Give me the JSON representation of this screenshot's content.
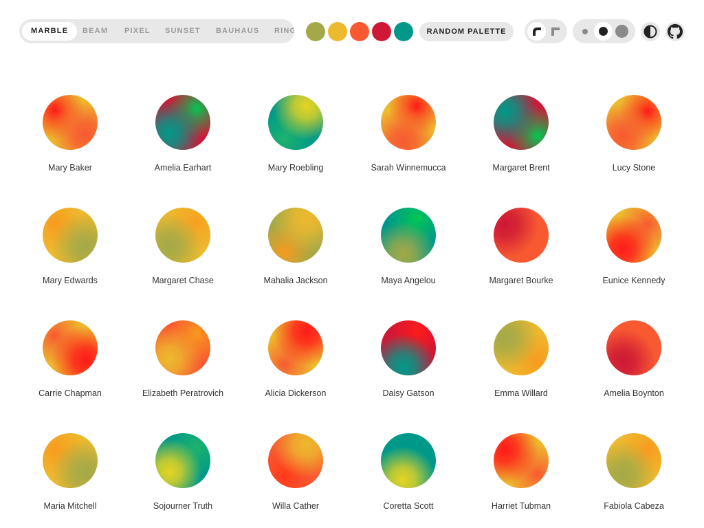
{
  "toolbar": {
    "tabs": [
      {
        "label": "MARBLE",
        "active": true
      },
      {
        "label": "BEAM",
        "active": false
      },
      {
        "label": "PIXEL",
        "active": false
      },
      {
        "label": "SUNSET",
        "active": false
      },
      {
        "label": "BAUHAUS",
        "active": false
      },
      {
        "label": "RING",
        "active": false
      }
    ],
    "palette": [
      "#a3a948",
      "#edb92e",
      "#f85931",
      "#ce1836",
      "#009989"
    ],
    "random_palette_label": "RANDOM PALETTE",
    "shape_toggle": {
      "icons": [
        "rounded-corner-icon",
        "square-corner-icon"
      ],
      "active": 0
    },
    "size_toggle": {
      "icons": [
        "small-dot-icon",
        "medium-dot-icon",
        "large-dot-icon"
      ],
      "active": 1
    },
    "dark_mode_icon": "contrast-icon",
    "github_icon": "github-icon"
  },
  "avatars": [
    {
      "name": "Mary Baker",
      "colors": [
        "#edb92e",
        "#f85931",
        "#ff1a1a"
      ]
    },
    {
      "name": "Amelia Earhart",
      "colors": [
        "#ce1836",
        "#009989",
        "#00c853"
      ]
    },
    {
      "name": "Mary Roebling",
      "colors": [
        "#009989",
        "#e6d422",
        "#1fb36b"
      ]
    },
    {
      "name": "Sarah Winnemucca",
      "colors": [
        "#edb92e",
        "#f85931",
        "#ff1a1a"
      ]
    },
    {
      "name": "Margaret Brent",
      "colors": [
        "#ce1836",
        "#009989",
        "#00c853"
      ]
    },
    {
      "name": "Lucy Stone",
      "colors": [
        "#edb92e",
        "#f85931",
        "#ff1a1a"
      ]
    },
    {
      "name": "Mary Edwards",
      "colors": [
        "#edb92e",
        "#a3a948",
        "#f89a1e"
      ]
    },
    {
      "name": "Margaret Chase",
      "colors": [
        "#edb92e",
        "#a3a948",
        "#f8a01e"
      ]
    },
    {
      "name": "Mahalia Jackson",
      "colors": [
        "#a3a948",
        "#edb92e",
        "#f89a1e"
      ]
    },
    {
      "name": "Maya Angelou",
      "colors": [
        "#009989",
        "#a3a948",
        "#00c853"
      ]
    },
    {
      "name": "Margaret Bourke",
      "colors": [
        "#f85931",
        "#ce1836",
        "#f85931"
      ]
    },
    {
      "name": "Eunice Kennedy",
      "colors": [
        "#edb92e",
        "#ff1a1a",
        "#f85931"
      ]
    },
    {
      "name": "Carrie Chapman",
      "colors": [
        "#edb92e",
        "#ff1a1a",
        "#f85931"
      ]
    },
    {
      "name": "Elizabeth Peratrovich",
      "colors": [
        "#f85931",
        "#edb92e",
        "#f89a1e"
      ]
    },
    {
      "name": "Alicia Dickerson",
      "colors": [
        "#edb92e",
        "#ff1a1a",
        "#f85931"
      ]
    },
    {
      "name": "Daisy Gatson",
      "colors": [
        "#ce1836",
        "#009989",
        "#ff1a1a"
      ]
    },
    {
      "name": "Emma Willard",
      "colors": [
        "#edb92e",
        "#a3a948",
        "#f89a1e"
      ]
    },
    {
      "name": "Amelia Boynton",
      "colors": [
        "#f85931",
        "#ce1836",
        "#f85931"
      ]
    },
    {
      "name": "Maria Mitchell",
      "colors": [
        "#edb92e",
        "#a3a948",
        "#f89a1e"
      ]
    },
    {
      "name": "Sojourner Truth",
      "colors": [
        "#009989",
        "#e6d422",
        "#1fb36b"
      ]
    },
    {
      "name": "Willa Cather",
      "colors": [
        "#f85931",
        "#edb92e",
        "#ff3a1a"
      ]
    },
    {
      "name": "Coretta Scott",
      "colors": [
        "#009989",
        "#e6d422",
        "#009989"
      ]
    },
    {
      "name": "Harriet Tubman",
      "colors": [
        "#edb92e",
        "#ff1a1a",
        "#f85931"
      ]
    },
    {
      "name": "Fabiola Cabeza",
      "colors": [
        "#edb92e",
        "#a3a948",
        "#f89a1e"
      ]
    }
  ]
}
